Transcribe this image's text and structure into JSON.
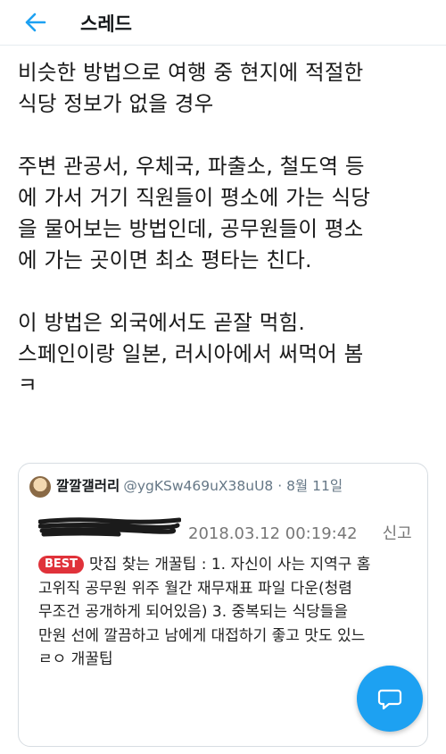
{
  "header": {
    "back_icon": "arrow-left-icon",
    "title": "스레드",
    "accent_color": "#1da1f2"
  },
  "tweet": {
    "lines": [
      "비슷한 방법으로 여행 중 현지에 적절한",
      "식당 정보가 없을 경우",
      "",
      "주변 관공서, 우체국, 파출소, 철도역 등",
      "에 가서 거기 직원들이 평소에 가는 식당",
      "을 물어보는 방법인데, 공무원들이 평소",
      "에 가는 곳이면 최소 평타는 친다.",
      "",
      "이 방법은 외국에서도 곧잘 먹힘.",
      "스페인이랑 일본, 러시아에서 써먹어 봄",
      "ㅋ"
    ]
  },
  "quote": {
    "author_name": "깔깔갤러리",
    "handle_date": "@ygKSw469uX38uU8 · 8월 11일",
    "screenshot": {
      "datetime": "2018.03.12 00:19:42",
      "report_label": "신고",
      "badge": "BEST",
      "first_line": "맛집 찾는 개꿀팁 : 1. 자신이 사는 지역구 홈",
      "lines": [
        "고위직 공무원 위주 월간 재무재표 파일 다운(청렴",
        "무조건 공개하게 되어있음) 3. 중복되는 식당들을",
        "만원 선에 깔끔하고 남에게 대접하기 좋고 맛도 있느",
        "ㄹㅇ 개꿀팁"
      ]
    }
  },
  "fab": {
    "icon": "reply-bubble-icon"
  }
}
